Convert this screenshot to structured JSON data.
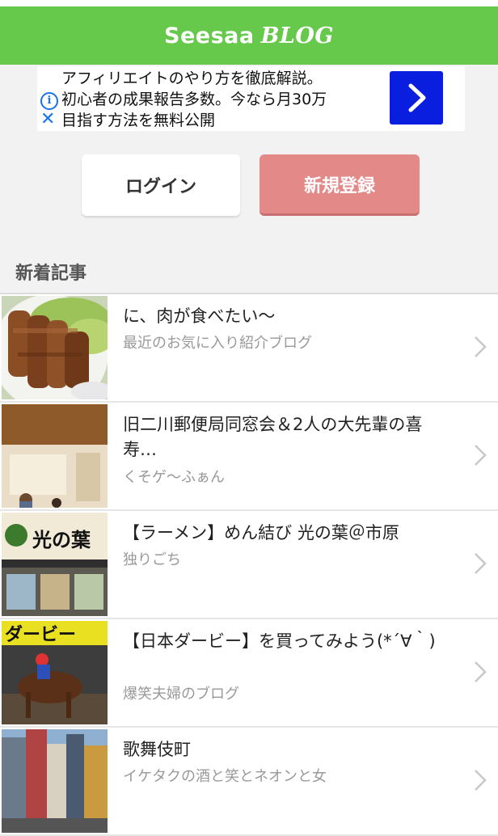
{
  "header": {
    "logo_main": "Seesaa",
    "logo_sub": "BLOG"
  },
  "ad": {
    "lines": [
      "アフィリエイトのやり方を徹底解説。",
      "初心者の成果報告多数。今なら月30万",
      "目指す方法を無料公開"
    ],
    "info_icon": "info-icon",
    "close_icon": "close-icon",
    "arrow_icon": "chevron-right-icon",
    "arrow_color": "#0a1ee0"
  },
  "buttons": {
    "login": "ログイン",
    "register": "新規登録"
  },
  "section": {
    "title": "新着記事"
  },
  "articles": [
    {
      "title": "に、肉が食べたい〜",
      "blog": "最近のお気に入り紹介ブログ"
    },
    {
      "title": "旧二川郵便局同窓会＆2人の大先輩の喜寿…",
      "blog": "くそゲ〜ふぁん"
    },
    {
      "title": "【ラーメン】めん結び 光の葉＠市原",
      "blog": "独りごち"
    },
    {
      "title": "【日本ダービー】を買ってみよう(*´∀｀)",
      "blog": "爆笑夫婦のブログ"
    },
    {
      "title": "歌舞伎町",
      "blog": "イケタクの酒と笑とネオンと女"
    }
  ],
  "thumb_texts": {
    "ramen_sign": "光の葉",
    "derby_sign": "ダービー"
  },
  "colors": {
    "header": "#66c94b",
    "register": "#e38a89"
  }
}
